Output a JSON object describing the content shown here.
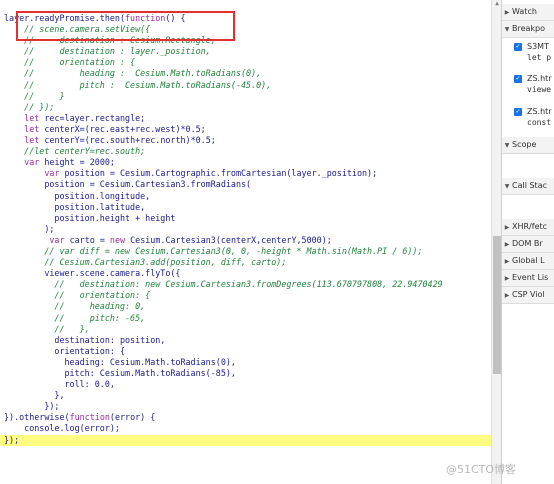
{
  "code_lines": [
    "layer.readyPromise.then(function() {",
    "    // scene.camera.setView({",
    "    //     destination : Cesium.Rectangle,",
    "    //     destination : layer._position,",
    "    //     orientation : {",
    "    //         heading :  Cesium.Math.toRadians(0),",
    "    //         pitch :  Cesium.Math.toRadians(-45.0),",
    "    //     }",
    "    // });",
    "    let rec=layer.rectangle;",
    "    let centerX=(rec.east+rec.west)*0.5;",
    "    let centerY=(rec.south+rec.north)*0.5;",
    "    //let centerY=rec.south;",
    "    var height = 2000;",
    "        var position = Cesium.Cartographic.fromCartesian(layer._position);",
    "        position = Cesium.Cartesian3.fromRadians(",
    "          position.longitude,",
    "          position.latitude,",
    "          position.height + height",
    "        );",
    "         var carto = new Cesium.Cartesian3(centerX,centerY,5000);",
    "        // var diff = new Cesium.Cartesian3(0, 0, -height * Math.sin(Math.PI / 6));",
    "        // Cesium.Cartesian3.add(position, diff, carto);",
    "        viewer.scene.camera.flyTo({",
    "          //   destination: new Cesium.Cartesian3.fromDegrees(113.670797808, 22.9470429",
    "          //   orientation: {",
    "          //     heading: 0,",
    "          //     pitch: -65,",
    "          //   },",
    "          destination: position,",
    "          orientation: {",
    "            heading: Cesium.Math.toRadians(0),",
    "            pitch: Cesium.Math.toRadians(-85),",
    "            roll: 0.0,",
    "          },",
    "        });",
    "}).otherwise(function(error) {",
    "    console.log(error);",
    "});"
  ],
  "sidebar": {
    "watch_label": "Watch",
    "breakpoints_label": "Breakpo",
    "breakpoints": [
      {
        "file": "S3MT",
        "code": "let p"
      },
      {
        "file": "ZS.htr",
        "code": "viewe"
      },
      {
        "file": "ZS.htr",
        "code": "const"
      }
    ],
    "scope_label": "Scope",
    "callstack_label": "Call Stac",
    "xhr_label": "XHR/fetc",
    "dom_label": "DOM Br",
    "global_label": "Global L",
    "event_label": "Event Lis",
    "csp_label": "CSP Viol"
  },
  "watermark": "@51CTO博客",
  "colors": {
    "callout_border": "#e0302f",
    "highlight_line": "#fffe80",
    "comment": "#23823f",
    "keyword": "#9a2c9f",
    "text": "#1c1c8a"
  }
}
